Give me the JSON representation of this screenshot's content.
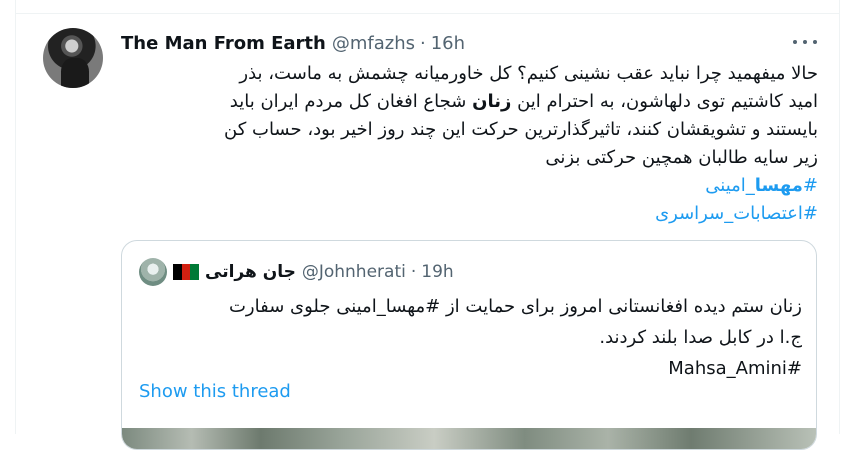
{
  "tweet": {
    "author": {
      "display_name": "The Man From Earth",
      "handle": "@mfazhs",
      "separator": "·",
      "time": "16h"
    },
    "more_icon": "more-horizontal-icon",
    "text_lines": [
      "حالا میفهمید چرا نباید عقب نشینی کنیم؟ کل خاورمیانه چشمش به ماست، بذر",
      "امید کاشتیم توی دلهاشون، به احترام این",
      "زنان",
      "شجاع افغان کل مردم ایران باید",
      "بایستند و تشویقشان کنند، تاثیرگذارترین حرکت این چند روز اخیر بود، حساب کن",
      "زیر سایه طالبان همچین حرکتی بزنی"
    ],
    "hashtags": [
      {
        "prefix": "#",
        "bold": "مهسا",
        "rest": "_امینی"
      },
      {
        "prefix": "#",
        "bold": "",
        "rest": "اعتصابات_سراسری"
      }
    ]
  },
  "quote": {
    "author": {
      "display_name": "جان هراتی",
      "handle": "@Johnherati",
      "separator": "·",
      "time": "19h"
    },
    "flag": {
      "colors": [
        "#000000",
        "#d32011",
        "#007a36"
      ]
    },
    "text_lines": [
      "زنان ستم دیده افغانستانی امروز برای حمایت از #مهسا_امینی جلوی سفارت",
      "ج.ا در کابل صدا بلند کردند.",
      "#Mahsa_Amini"
    ],
    "show_thread": "Show this thread"
  },
  "colors": {
    "accent": "#1d9bf0",
    "secondary_text": "#536471",
    "border": "#cfd9de"
  }
}
